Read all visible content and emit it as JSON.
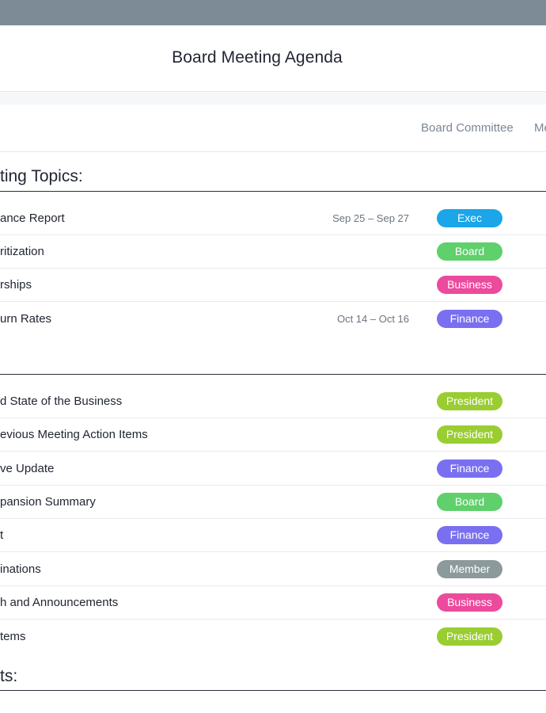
{
  "header": {
    "title": "Board Meeting Agenda"
  },
  "filters": {
    "tabs": [
      {
        "label": "Board Committee"
      },
      {
        "label": "Me"
      }
    ]
  },
  "sections": [
    {
      "title": "ting Topics:",
      "rows": [
        {
          "name": "ance Report",
          "date": "Sep 25 – Sep 27",
          "tag": "Exec",
          "tag_color": "#1aa6e8"
        },
        {
          "name": "ritization",
          "date": "",
          "tag": "Board",
          "tag_color": "#5fd06b"
        },
        {
          "name": "rships",
          "date": "",
          "tag": "Business",
          "tag_color": "#ec4a9c"
        },
        {
          "name": "urn Rates",
          "date": "Oct 14 – Oct 16",
          "tag": "Finance",
          "tag_color": "#7a6ff0"
        }
      ]
    },
    {
      "title": "",
      "rows": [
        {
          "name": "d State of the Business",
          "tag": "President",
          "tag_color": "#9acd32"
        },
        {
          "name": "evious Meeting Action Items",
          "tag": "President",
          "tag_color": "#9acd32"
        },
        {
          "name": "ve Update",
          "tag": "Finance",
          "tag_color": "#7a6ff0"
        },
        {
          "name": "pansion Summary",
          "tag": "Board",
          "tag_color": "#5fd06b"
        },
        {
          "name": "t",
          "tag": "Finance",
          "tag_color": "#7a6ff0"
        },
        {
          "name": "inations",
          "tag": "Member",
          "tag_color": "#8c9a9b"
        },
        {
          "name": "h and Announcements",
          "tag": "Business",
          "tag_color": "#ec4a9c"
        },
        {
          "name": "tems",
          "tag": "President",
          "tag_color": "#9acd32"
        }
      ]
    },
    {
      "title": "ts:",
      "rows": []
    }
  ]
}
